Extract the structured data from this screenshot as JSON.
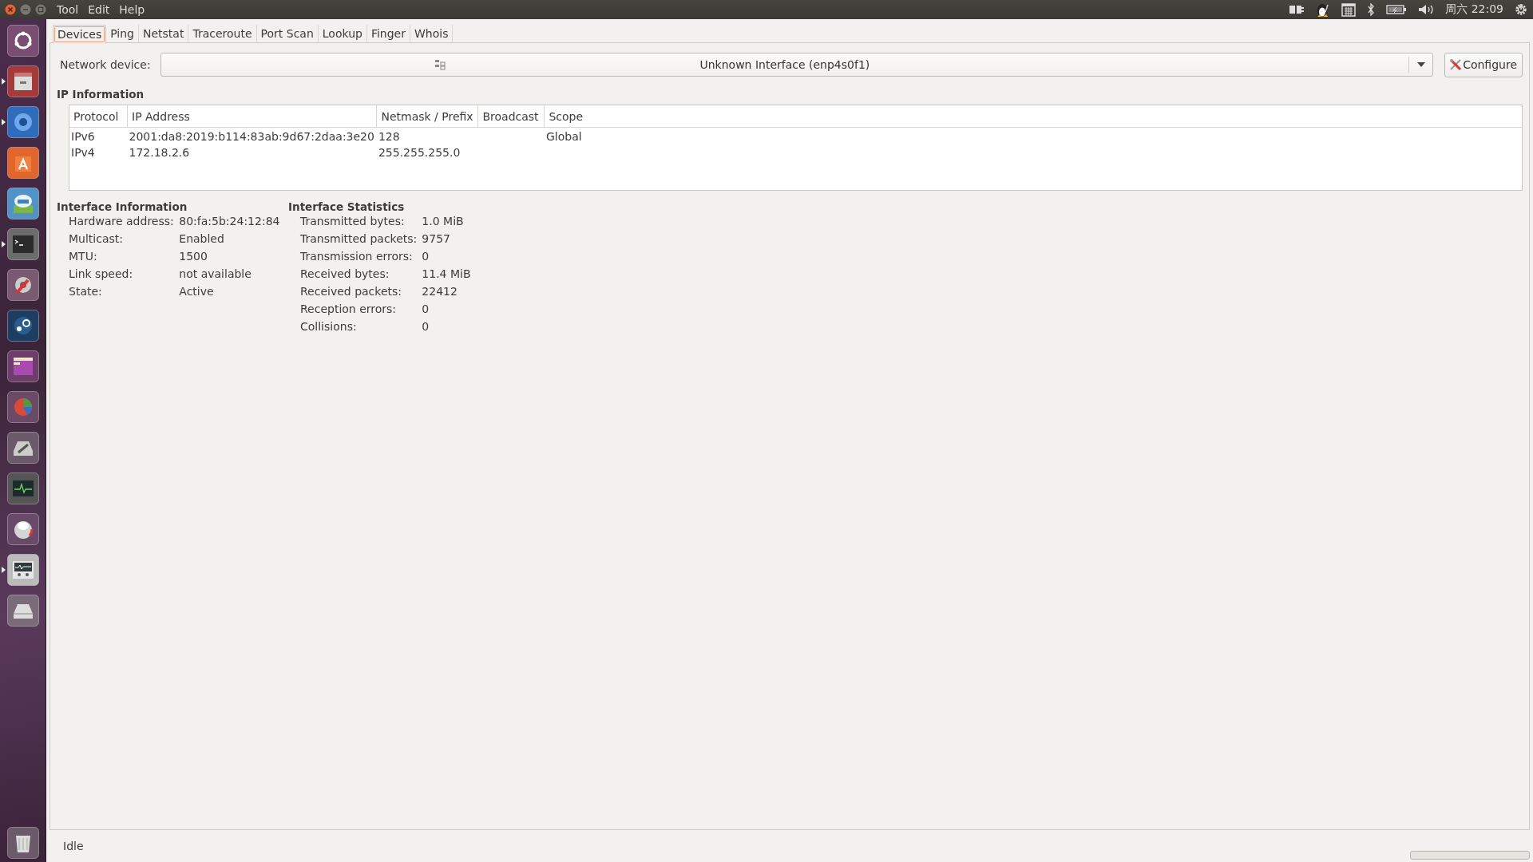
{
  "window": {
    "menus": [
      "Tool",
      "Edit",
      "Help"
    ]
  },
  "top_panel": {
    "clock": "周六 22:09"
  },
  "launcher": [
    {
      "kind": "home",
      "running": false
    },
    {
      "kind": "files",
      "running": true
    },
    {
      "kind": "browser",
      "running": true
    },
    {
      "kind": "store",
      "running": false
    },
    {
      "kind": "mail",
      "running": false
    },
    {
      "kind": "terminal",
      "running": true
    },
    {
      "kind": "tools",
      "running": false
    },
    {
      "kind": "steam",
      "running": false
    },
    {
      "kind": "window",
      "running": false
    },
    {
      "kind": "pie",
      "running": false
    },
    {
      "kind": "disk-tool",
      "running": false
    },
    {
      "kind": "monitor",
      "running": false
    },
    {
      "kind": "dial",
      "running": false
    },
    {
      "kind": "network",
      "running": true
    },
    {
      "kind": "drive",
      "running": false
    },
    {
      "kind": "trash",
      "running": false
    }
  ],
  "tabs": [
    {
      "label": "Devices",
      "selected": true
    },
    {
      "label": "Ping",
      "selected": false
    },
    {
      "label": "Netstat",
      "selected": false
    },
    {
      "label": "Traceroute",
      "selected": false
    },
    {
      "label": "Port Scan",
      "selected": false
    },
    {
      "label": "Lookup",
      "selected": false
    },
    {
      "label": "Finger",
      "selected": false
    },
    {
      "label": "Whois",
      "selected": false
    }
  ],
  "device": {
    "label": "Network device:",
    "value": "Unknown Interface (enp4s0f1)",
    "button": "Configure"
  },
  "ip_information": {
    "title": "IP Information",
    "columns": [
      "Protocol",
      "IP Address",
      "Netmask / Prefix",
      "Broadcast",
      "Scope"
    ],
    "rows": [
      [
        "IPv6",
        "2001:da8:2019:b114:83ab:9d67:2daa:3e20",
        "128",
        "",
        "Global"
      ],
      [
        "IPv4",
        "172.18.2.6",
        "255.255.255.0",
        "",
        ""
      ]
    ]
  },
  "interface_information": {
    "title": "Interface Information",
    "fields": [
      {
        "label": "Hardware address:",
        "value": "80:fa:5b:24:12:84"
      },
      {
        "label": "Multicast:",
        "value": "Enabled"
      },
      {
        "label": "MTU:",
        "value": "1500"
      },
      {
        "label": "Link speed:",
        "value": "not available"
      },
      {
        "label": "State:",
        "value": "Active"
      }
    ]
  },
  "interface_statistics": {
    "title": "Interface Statistics",
    "fields": [
      {
        "label": "Transmitted bytes:",
        "value": "1.0 MiB"
      },
      {
        "label": "Transmitted packets:",
        "value": "9757"
      },
      {
        "label": "Transmission errors:",
        "value": "0"
      },
      {
        "label": "Received bytes:",
        "value": "11.4 MiB"
      },
      {
        "label": "Received packets:",
        "value": "22412"
      },
      {
        "label": "Reception errors:",
        "value": "0"
      },
      {
        "label": "Collisions:",
        "value": "0"
      }
    ]
  },
  "status_bar": {
    "text": "Idle",
    "progress": {
      "level": 0
    }
  }
}
